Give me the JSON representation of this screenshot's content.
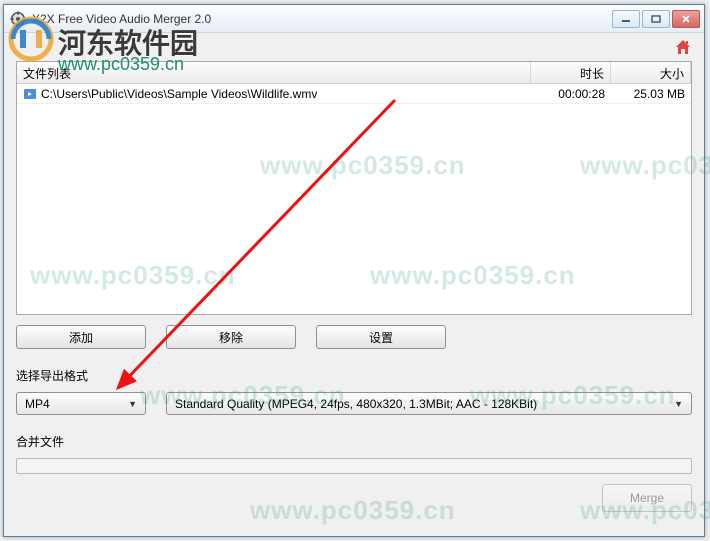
{
  "window": {
    "title": "X2X Free Video Audio Merger 2.0"
  },
  "watermark": {
    "site_name": "河东软件园",
    "url": "www.pc0359.cn",
    "repeat_text": "www.pc0359.cn"
  },
  "file_list": {
    "headers": {
      "filename": "文件列表",
      "duration": "时长",
      "size": "大小"
    },
    "rows": [
      {
        "path": "C:\\Users\\Public\\Videos\\Sample Videos\\Wildlife.wmv",
        "duration": "00:00:28",
        "size": "25.03 MB"
      }
    ]
  },
  "buttons": {
    "add": "添加",
    "remove": "移除",
    "settings": "设置",
    "merge": "Merge"
  },
  "output_format": {
    "label": "选择导出格式",
    "format_selected": "MP4",
    "quality_selected": "Standard Quality  (MPEG4,  24fps,  480x320,  1.3MBit;   AAC - 128KBit)"
  },
  "merge_section": {
    "label": "合并文件"
  }
}
